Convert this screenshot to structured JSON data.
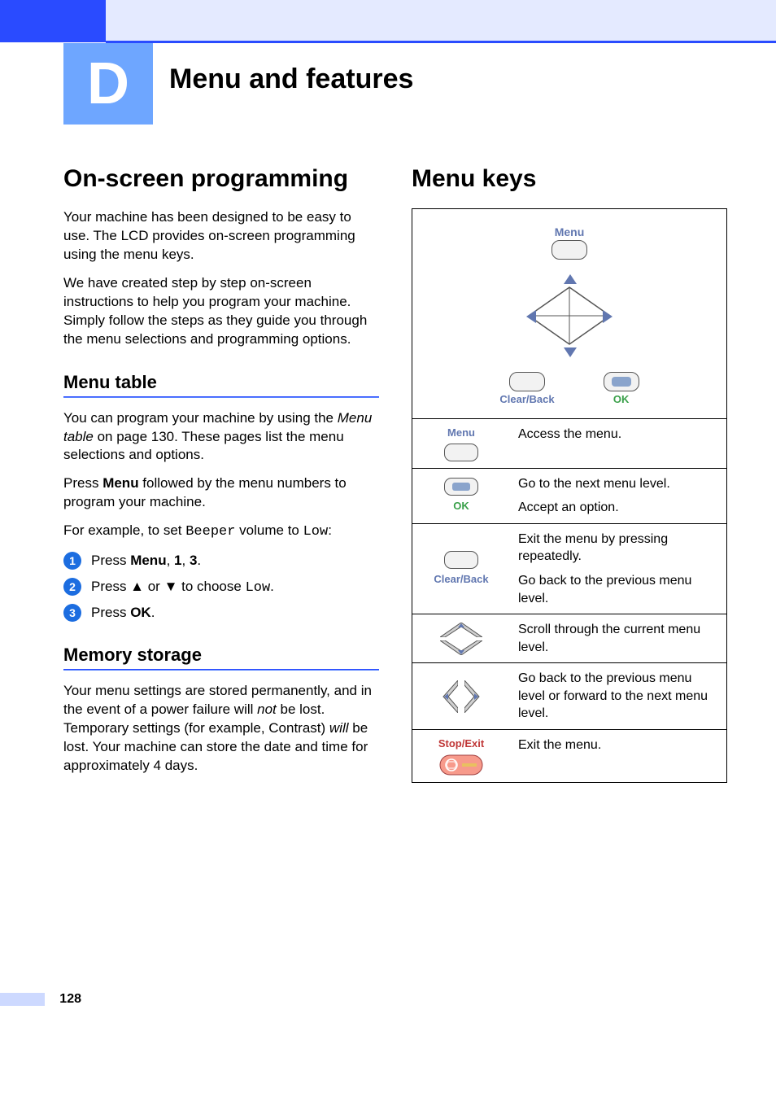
{
  "chapter": {
    "letter": "D",
    "title": "Menu and features"
  },
  "left": {
    "h2": "On-screen programming",
    "p1": "Your machine has been designed to be easy to use. The LCD provides on-screen programming using the menu keys.",
    "p2": "We have created step by step on-screen instructions to help you program your machine. Simply follow the steps as they guide you through the menu selections and programming options.",
    "sub1": "Menu table",
    "p3a": "You can program your machine by using the ",
    "p3_em": "Menu table",
    "p3b": " on page 130. These pages list the menu selections and options.",
    "p4a": "Press ",
    "p4_menu": "Menu",
    "p4b": " followed by the menu numbers to program your machine.",
    "p5a": "For example, to set ",
    "p5_beeper": "Beeper",
    "p5b": " volume to ",
    "p5_low": "Low",
    "p5c": ":",
    "steps": [
      {
        "n": "1",
        "pre": "Press ",
        "bold": "Menu",
        "mid": ", ",
        "bold2": "1",
        "mid2": ", ",
        "bold3": "3",
        "post": "."
      },
      {
        "n": "2",
        "pre": "Press ▲ or ▼ to choose ",
        "mono": "Low",
        "post": "."
      },
      {
        "n": "3",
        "pre": "Press ",
        "bold": "OK",
        "post": "."
      }
    ],
    "sub2": "Memory storage",
    "p6a": "Your menu settings are stored permanently, and in the event of a power failure will ",
    "p6_em1": "not",
    "p6b": " be lost. Temporary settings (for example, Contrast) ",
    "p6_em2": "will",
    "p6c": " be lost. Your machine can store the date and time for approximately 4 days."
  },
  "right": {
    "h2": "Menu keys",
    "labels": {
      "menu": "Menu",
      "clear": "Clear/Back",
      "ok": "OK",
      "stop": "Stop/Exit"
    },
    "rows": [
      {
        "key": "menu",
        "desc": "Access the menu."
      },
      {
        "key": "ok",
        "desc1": "Go to the next menu level.",
        "desc2": "Accept an option."
      },
      {
        "key": "clear",
        "desc1": "Exit the menu by pressing repeatedly.",
        "desc2": "Go back to the previous menu level."
      },
      {
        "key": "updown",
        "desc": "Scroll through the current menu level."
      },
      {
        "key": "leftright",
        "desc": "Go back to the previous menu level or forward to the next menu level."
      },
      {
        "key": "stop",
        "desc": "Exit the menu."
      }
    ]
  },
  "page_number": "128"
}
